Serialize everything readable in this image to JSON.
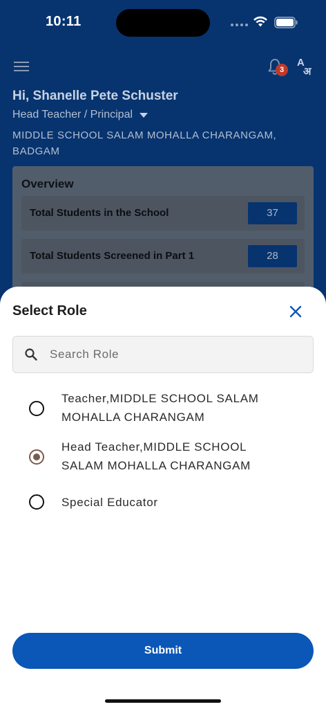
{
  "status_bar": {
    "time": "10:11"
  },
  "header": {
    "notification_count": "3",
    "translate_glyph_top": "A",
    "translate_glyph_bottom": "अ"
  },
  "profile": {
    "greeting": "Hi, Shanelle Pete Schuster",
    "role": "Head Teacher / Principal",
    "school": "MIDDLE SCHOOL SALAM MOHALLA CHARANGAM, BADGAM"
  },
  "overview": {
    "title": "Overview",
    "rows": [
      {
        "label": "Total Students in the School",
        "value": "37"
      },
      {
        "label": "Total Students Screened in Part 1",
        "value": "28"
      }
    ]
  },
  "sheet": {
    "title": "Select Role",
    "search_placeholder": "Search Role",
    "search_value": "",
    "options": [
      {
        "label": "Teacher,MIDDLE SCHOOL SALAM MOHALLA CHARANGAM",
        "selected": false
      },
      {
        "label": "Head Teacher,MIDDLE SCHOOL SALAM MOHALLA CHARANGAM",
        "selected": true
      },
      {
        "label": "Special Educator",
        "selected": false
      }
    ],
    "submit_label": "Submit"
  },
  "colors": {
    "primary": "#0a57b8",
    "header_bg": "#07346f",
    "radio_selected": "#7a5a4e",
    "badge": "#c0392b"
  },
  "icons": {
    "menu": "menu-icon",
    "bell": "bell-icon",
    "translate": "translate-icon",
    "close": "close-icon",
    "search": "search-icon"
  }
}
